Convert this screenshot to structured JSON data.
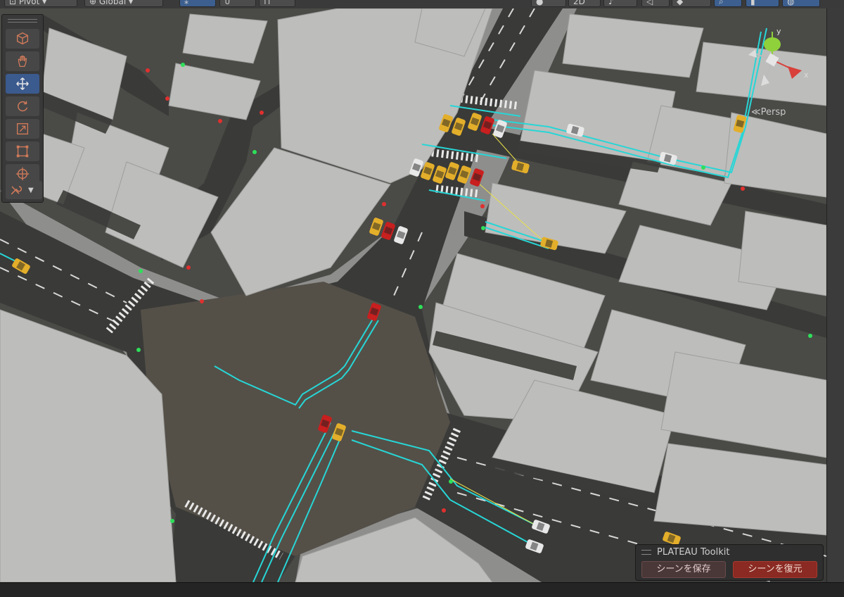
{
  "toolbar": {
    "pivot_label": "Pivot",
    "global_label": "Global",
    "view_2d_label": "2D"
  },
  "tools": [
    {
      "name": "view-tool",
      "icon": "cube-icon"
    },
    {
      "name": "hand-tool",
      "icon": "hand-icon"
    },
    {
      "name": "move-tool",
      "icon": "move-arrows-icon",
      "active": true
    },
    {
      "name": "rotate-tool",
      "icon": "rotate-icon"
    },
    {
      "name": "scale-tool",
      "icon": "scale-icon"
    },
    {
      "name": "rect-tool",
      "icon": "rect-transform-icon"
    },
    {
      "name": "transform-tool",
      "icon": "transform-icon"
    },
    {
      "name": "custom-tool",
      "icon": "wrench-icon"
    }
  ],
  "gizmo": {
    "y_label": "y",
    "x_label": "x",
    "persp_label": "Persp",
    "colors": {
      "x": "#d8403a",
      "y": "#8fd13a",
      "z": "#3a78d8"
    }
  },
  "plateau_panel": {
    "title": "PLATEAU Toolkit",
    "save_label": "シーンを保存",
    "restore_label": "シーンを復元"
  },
  "scene": {
    "colors": {
      "ground": "#4a4a47",
      "building": "#bdbdbb",
      "lane": "#27d6d6",
      "taxi": "#e3ae2a",
      "red_car": "#c81f1f",
      "white_car": "#e8e8e8"
    }
  }
}
